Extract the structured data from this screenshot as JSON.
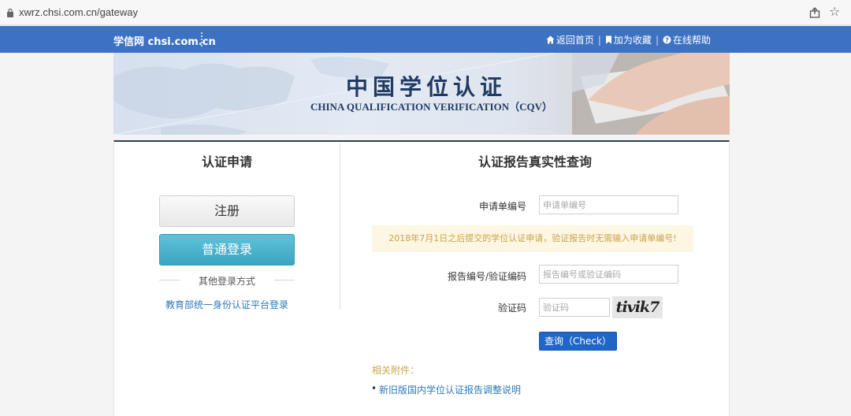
{
  "browser": {
    "url": "xwrz.chsi.com.cn/gateway",
    "icons": {
      "lock": "lock-icon",
      "share": "share-icon",
      "star": "star-icon"
    }
  },
  "navbar": {
    "brand": "学信网 chsi.com.cn",
    "links": [
      {
        "icon": "home-icon",
        "label": "返回首页"
      },
      {
        "icon": "bookmark-icon",
        "label": "加为收藏"
      },
      {
        "icon": "help-icon",
        "label": "在线帮助"
      }
    ],
    "colors": {
      "background": "#3d72c2"
    }
  },
  "banner": {
    "title_cn": "中国学位认证",
    "title_en": "CHINA QUALIFICATION VERIFICATION（CQV）"
  },
  "left_panel": {
    "title": "认证申请",
    "register_label": "注册",
    "login_label": "普通登录",
    "other_login_label": "其他登录方式",
    "edu_link_label": "教育部统一身份认证平台登录"
  },
  "right_panel": {
    "title": "认证报告真实性查询",
    "application_label": "申请单编号",
    "application_placeholder": "申请单编号",
    "notice": "2018年7月1日之后提交的学位认证申请，验证报告时无需输入申请单编号!",
    "report_label": "报告编号/验证编码",
    "report_placeholder": "报告编号或验证编码",
    "captcha_label": "验证码",
    "captcha_placeholder": "验证码",
    "captcha_text": "tivik7",
    "check_label": "查询（Check）",
    "attachments_title": "相关附件：",
    "attachments": [
      "新旧版国内学位认证报告调整说明"
    ]
  }
}
